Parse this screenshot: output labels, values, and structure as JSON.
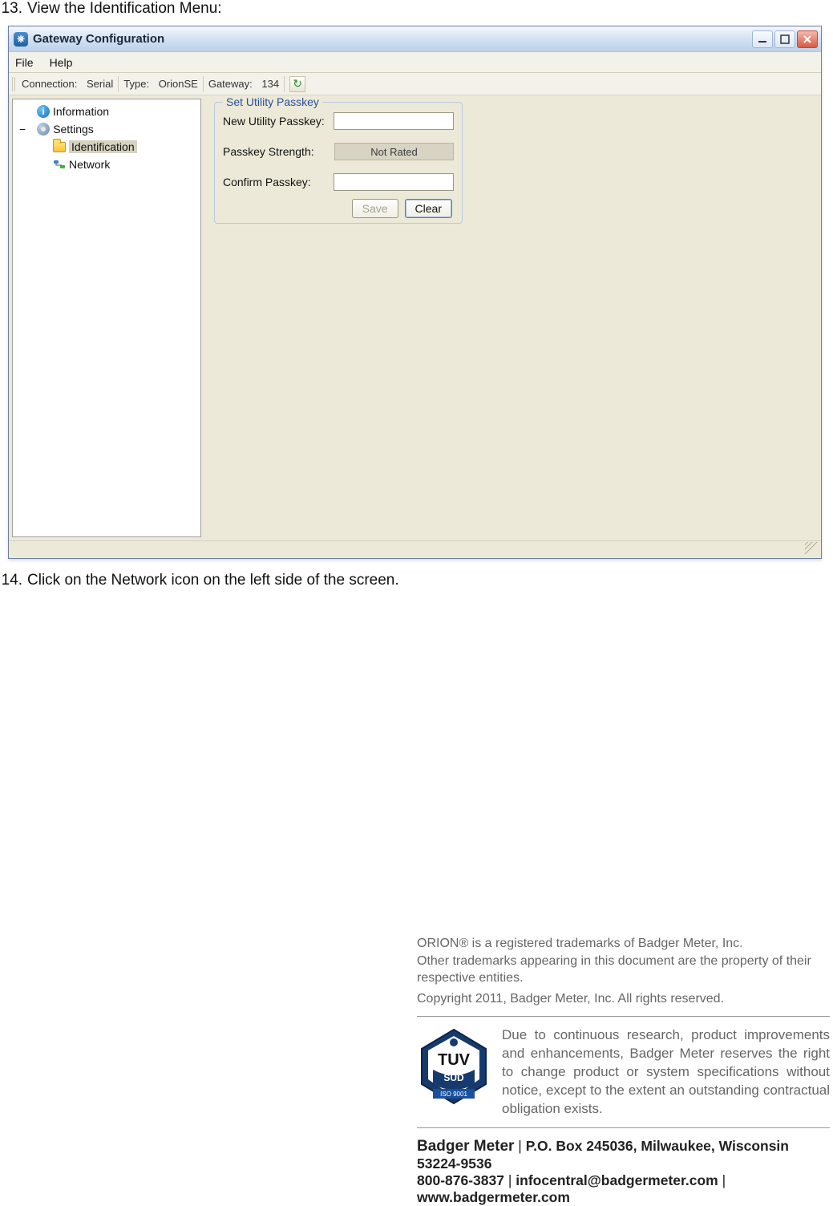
{
  "steps": {
    "s13_num": "13.",
    "s13_text": "View the Identification Menu:",
    "s14_num": "14.",
    "s14_text": "Click on the Network icon on the left side of the screen."
  },
  "window": {
    "title": "Gateway Configuration",
    "menu": {
      "file": "File",
      "help": "Help"
    },
    "toolbar": {
      "connection_label": "Connection:",
      "connection_value": "Serial",
      "type_label": "Type:",
      "type_value": "OrionSE",
      "gateway_label": "Gateway:",
      "gateway_value": "134"
    },
    "tree": {
      "information": "Information",
      "settings": "Settings",
      "identification": "Identification",
      "network": "Network"
    },
    "passkey": {
      "legend": "Set Utility Passkey",
      "new_label": "New Utility Passkey:",
      "strength_label": "Passkey Strength:",
      "strength_value": "Not Rated",
      "confirm_label": "Confirm Passkey:",
      "save": "Save",
      "clear": "Clear"
    }
  },
  "footer": {
    "trademark_line1": "ORION® is a registered trademarks of Badger Meter, Inc.",
    "trademark_line2": "Other trademarks appearing in this document are the property of their respective entities.",
    "copyright": "Copyright 2011, Badger Meter, Inc. All rights reserved.",
    "disclaimer": "Due to continuous research, product improvements and enhancements, Badger Meter reserves the right to change product or system specifications without notice, except to the extent an outstanding contractual obligation exists.",
    "brand": "Badger Meter",
    "address": "P.O. Box 245036, Milwaukee, Wisconsin 53224-9536",
    "phone": "800-876-3837",
    "email": "infocentral@badgermeter.com",
    "website": "www.badgermeter.com",
    "tuv_top": "TUV",
    "tuv_sud": "SUD",
    "tuv_iso": "ISO 9001"
  }
}
